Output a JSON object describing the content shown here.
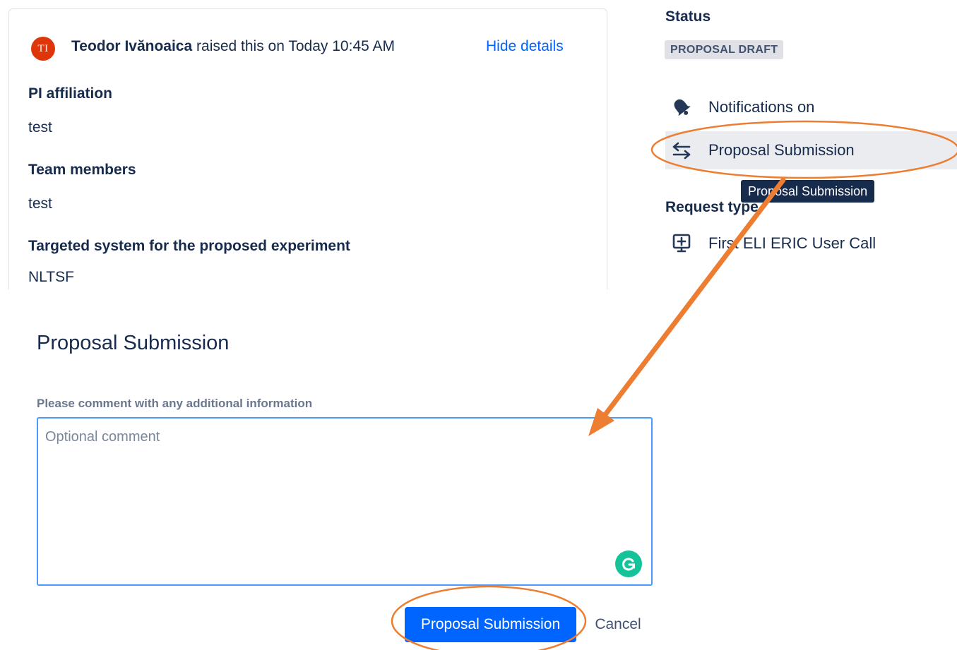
{
  "request": {
    "avatar_initials": "TI",
    "author_name": "Teodor Ivănoaica",
    "raised_text": "raised this on Today 10:45 AM",
    "hide_details_label": "Hide details",
    "fields": [
      {
        "label": "PI affiliation",
        "value": "test"
      },
      {
        "label": "Team members",
        "value": "test"
      },
      {
        "label": "Targeted system for the proposed experiment",
        "value": "NLTSF"
      }
    ]
  },
  "sidebar": {
    "status_heading": "Status",
    "status_value": "PROPOSAL DRAFT",
    "notifications_label": "Notifications on",
    "transition_label": "Proposal Submission",
    "tooltip_text": "Proposal Submission",
    "request_type_heading": "Request type",
    "request_type_value": "First ELI ERIC User Call"
  },
  "dialog": {
    "title": "Proposal Submission",
    "comment_label": "Please comment with any additional information",
    "comment_placeholder": "Optional comment",
    "comment_value": "",
    "submit_label": "Proposal Submission",
    "cancel_label": "Cancel"
  },
  "colors": {
    "primary": "#0065ff",
    "avatar": "#de350b",
    "annotation": "#ed7d31",
    "grammarly": "#15c39a",
    "heading": "#172b4d"
  },
  "icons": {
    "notifications": "bell-icon",
    "transition": "transition-arrows-icon",
    "request_type": "monitor-plus-icon",
    "grammarly": "grammarly-icon"
  }
}
